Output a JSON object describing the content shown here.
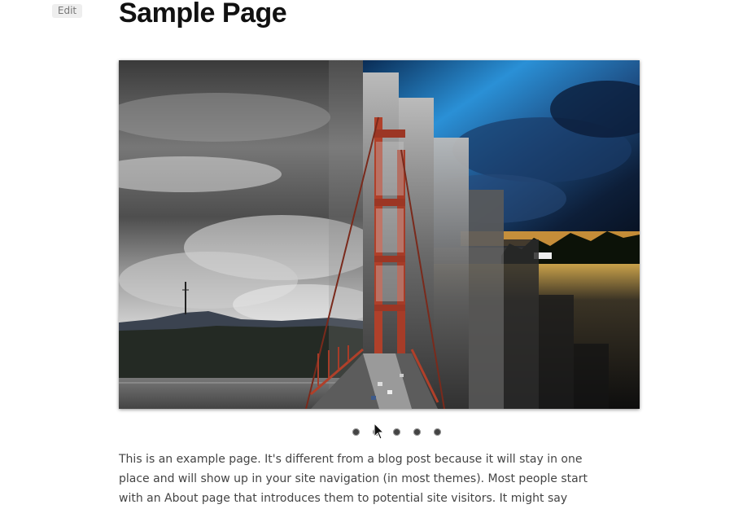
{
  "edit_label": "Edit",
  "page_title": "Sample Page",
  "slider": {
    "slide_count": 5,
    "active_slide": 1
  },
  "content": {
    "paragraph": "This is an example page. It's different from a blog post because it will stay in one place and will show up in your site navigation (in most themes). Most people start with an About page that introduces them to potential site visitors. It might say something like this:"
  },
  "colors": {
    "title": "#111111",
    "body_text": "#444444",
    "edit_bg": "#eeeeee",
    "bridge_red": "#b0402a",
    "sky_blue": "#2a7fc0"
  }
}
